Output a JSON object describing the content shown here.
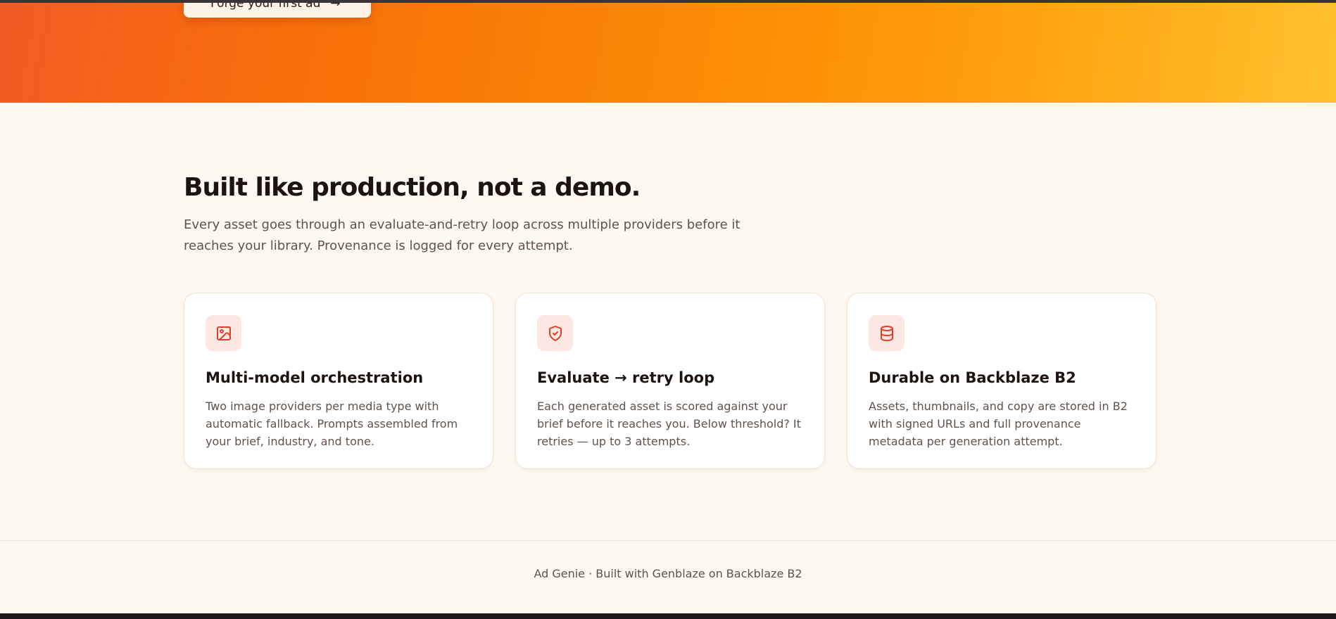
{
  "hero": {
    "cta_label": "Forge your first ad",
    "cta_arrow": "→"
  },
  "features": {
    "title": "Built like production, not a demo.",
    "subtitle": "Every asset goes through an evaluate-and-retry loop across multiple providers before it reaches your library. Provenance is logged for every attempt.",
    "cards": [
      {
        "icon": "image-icon",
        "title": "Multi-model orchestration",
        "text": "Two image providers per media type with automatic fallback. Prompts assembled from your brief, industry, and tone."
      },
      {
        "icon": "shield-check-icon",
        "title": "Evaluate → retry loop",
        "text": "Each generated asset is scored against your brief before it reaches you. Below threshold? It retries — up to 3 attempts."
      },
      {
        "icon": "database-icon",
        "title": "Durable on Backblaze B2",
        "text": "Assets, thumbnails, and copy are stored in B2 with signed URLs and full provenance metadata per generation attempt."
      }
    ]
  },
  "footer": {
    "text": "Ad Genie · Built with Genblaze on Backblaze B2"
  },
  "colors": {
    "accent": "#e0402a",
    "icon_bg": "#fde7e3",
    "page_bg": "#fdf8f1"
  }
}
